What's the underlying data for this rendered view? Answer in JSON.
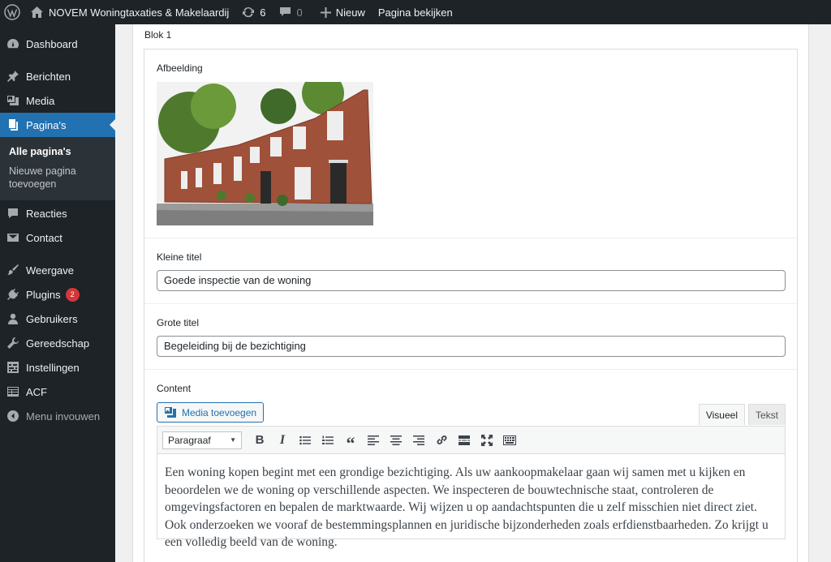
{
  "adminbar": {
    "site_name": "NOVEM Woningtaxaties & Makelaardij",
    "updates_count": "6",
    "comments_count": "0",
    "new_label": "Nieuw",
    "view_page_label": "Pagina bekijken"
  },
  "sidebar": {
    "items": [
      {
        "label": "Dashboard",
        "icon": "dashboard-icon"
      },
      {
        "label": "Berichten",
        "icon": "pin-icon"
      },
      {
        "label": "Media",
        "icon": "media-icon"
      },
      {
        "label": "Pagina's",
        "icon": "pages-icon"
      },
      {
        "label": "Reacties",
        "icon": "comments-icon"
      },
      {
        "label": "Contact",
        "icon": "mail-icon"
      },
      {
        "label": "Weergave",
        "icon": "appearance-icon"
      },
      {
        "label": "Plugins",
        "icon": "plugins-icon",
        "badge": "2"
      },
      {
        "label": "Gebruikers",
        "icon": "users-icon"
      },
      {
        "label": "Gereedschap",
        "icon": "tools-icon"
      },
      {
        "label": "Instellingen",
        "icon": "settings-icon"
      },
      {
        "label": "ACF",
        "icon": "acf-icon"
      },
      {
        "label": "Menu invouwen",
        "icon": "collapse-icon"
      }
    ],
    "submenu": {
      "all_pages": "Alle pagina's",
      "new_page": "Nieuwe pagina toevoegen"
    }
  },
  "main": {
    "blok_label": "Blok 1",
    "image_label": "Afbeelding",
    "small_title_label": "Kleine titel",
    "small_title_value": "Goede inspectie van de woning",
    "big_title_label": "Grote titel",
    "big_title_value": "Begeleiding bij de bezichtiging",
    "content_label": "Content",
    "media_button": "Media toevoegen",
    "tab_visual": "Visueel",
    "tab_text": "Tekst",
    "format_select": "Paragraaf",
    "editor_text": "Een woning kopen begint met een grondige bezichtiging. Als uw aankoopmakelaar gaan wij samen met u kijken en beoordelen we de woning op verschillende aspecten. We inspecteren de bouwtechnische staat, controleren de omgevingsfactoren en bepalen de marktwaarde. Wij wijzen u op aandachtspunten die u zelf misschien niet direct ziet. Ook onderzoeken we vooraf de bestemmingsplannen en juridische bijzonderheden zoals erfdienstbaarheden. Zo krijgt u een volledig beeld van de woning."
  },
  "colors": {
    "admin_dark": "#1d2327",
    "accent_blue": "#2271b1",
    "badge_red": "#d63638"
  }
}
